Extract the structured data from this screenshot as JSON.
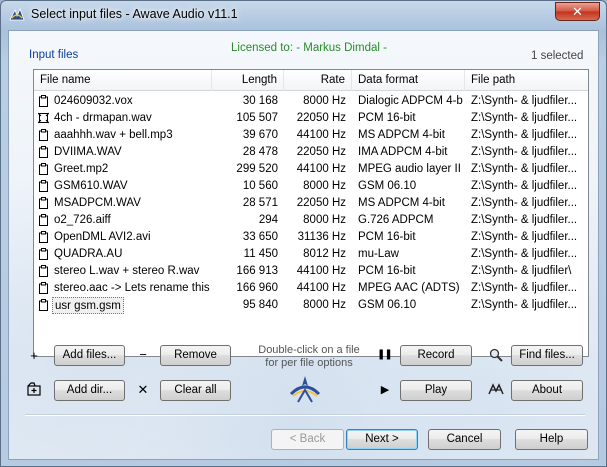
{
  "window": {
    "title": "Select input files - Awave Audio v11.1",
    "close_glyph": "✕",
    "app_icon": "awave-app-icon"
  },
  "header": {
    "group_label": "Input files",
    "licensed": "Licensed to: - Markus Dimdal -",
    "selected": "1 selected"
  },
  "table": {
    "columns": [
      "File name",
      "Length",
      "Rate",
      "Data format",
      "File path"
    ],
    "rows": [
      {
        "name": "024609032.vox",
        "length": "30 168",
        "rate": "8000 Hz",
        "format": "Dialogic ADPCM 4-bit",
        "path": "Z:\\Synth- & ljudfiler...",
        "icon": "clipboard-file-icon"
      },
      {
        "name": "4ch - drmapan.wav",
        "length": "105 507",
        "rate": "22050 Hz",
        "format": "PCM 16-bit",
        "path": "Z:\\Synth- & ljudfiler...",
        "icon": "multichannel-file-icon"
      },
      {
        "name": "aaahhh.wav + bell.mp3",
        "length": "39 670",
        "rate": "44100 Hz",
        "format": "MS ADPCM 4-bit",
        "path": "Z:\\Synth- & ljudfiler...",
        "icon": "clipboard-file-icon"
      },
      {
        "name": "DVIIMA.WAV",
        "length": "28 478",
        "rate": "22050 Hz",
        "format": "IMA ADPCM 4-bit",
        "path": "Z:\\Synth- & ljudfiler...",
        "icon": "clipboard-file-icon"
      },
      {
        "name": "Greet.mp2",
        "length": "299 520",
        "rate": "44100 Hz",
        "format": "MPEG audio layer II",
        "path": "Z:\\Synth- & ljudfiler...",
        "icon": "clipboard-file-icon"
      },
      {
        "name": "GSM610.WAV",
        "length": "10 560",
        "rate": "8000 Hz",
        "format": "GSM 06.10",
        "path": "Z:\\Synth- & ljudfiler...",
        "icon": "clipboard-file-icon"
      },
      {
        "name": "MSADPCM.WAV",
        "length": "28 571",
        "rate": "22050 Hz",
        "format": "MS ADPCM 4-bit",
        "path": "Z:\\Synth- & ljudfiler...",
        "icon": "clipboard-file-icon"
      },
      {
        "name": "o2_726.aiff",
        "length": "294",
        "rate": "8000 Hz",
        "format": "G.726 ADPCM",
        "path": "Z:\\Synth- & ljudfiler...",
        "icon": "clipboard-file-icon"
      },
      {
        "name": "OpenDML AVI2.avi",
        "length": "33 650",
        "rate": "31136 Hz",
        "format": "PCM 16-bit",
        "path": "Z:\\Synth- & ljudfiler...",
        "icon": "clipboard-file-icon"
      },
      {
        "name": "QUADRA.AU",
        "length": "11 450",
        "rate": "8012 Hz",
        "format": "mu-Law",
        "path": "Z:\\Synth- & ljudfiler...",
        "icon": "clipboard-file-icon"
      },
      {
        "name": "stereo L.wav + stereo R.wav",
        "length": "166 913",
        "rate": "44100 Hz",
        "format": "PCM 16-bit",
        "path": "Z:\\Synth- & ljudfiler\\",
        "icon": "clipboard-file-icon"
      },
      {
        "name": "stereo.aac -> Lets rename this",
        "length": "166 960",
        "rate": "44100 Hz",
        "format": "MPEG AAC (ADTS)",
        "path": "Z:\\Synth- & ljudfiler...",
        "icon": "clipboard-file-icon"
      },
      {
        "name": "usr gsm.gsm",
        "length": "95 840",
        "rate": "8000 Hz",
        "format": "GSM 06.10",
        "path": "Z:\\Synth- & ljudfiler...",
        "icon": "clipboard-file-icon"
      }
    ]
  },
  "buttons": {
    "add_files": "Add files...",
    "remove": "Remove",
    "add_dir": "Add dir...",
    "clear_all": "Clear all",
    "record": "Record",
    "play": "Play",
    "find_files": "Find files...",
    "about": "About",
    "back": "< Back",
    "next": "Next >",
    "cancel": "Cancel",
    "help": "Help"
  },
  "icons": {
    "add": "+",
    "remove": "−",
    "clear": "✕",
    "pause": "❚❚",
    "play": "▶",
    "search": "🔍"
  },
  "hint": {
    "line1": "Double-click on a file",
    "line2": "for per file options"
  },
  "colors": {
    "accent_link": "#0b3e9e",
    "licensed_green": "#2b8a2b",
    "close_red": "#c7432c"
  }
}
